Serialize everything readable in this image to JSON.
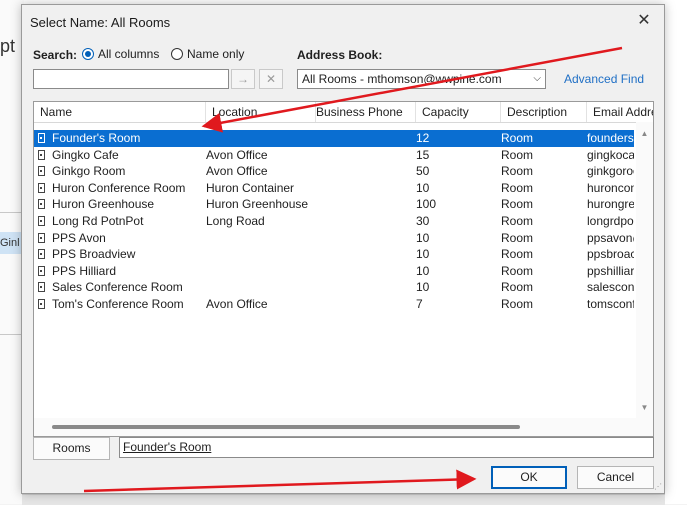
{
  "background": {
    "partial_title": "pt",
    "partial_item": "Ginl"
  },
  "dialog": {
    "title": "Select Name: All Rooms"
  },
  "search": {
    "label": "Search:",
    "option_all": "All columns",
    "option_name": "Name only",
    "selected_option": "All columns",
    "value": "",
    "go_icon": "arrow-right-icon",
    "clear_icon": "x-icon"
  },
  "address_book": {
    "label": "Address Book:",
    "value": "All Rooms - mthomson@wwpine.com",
    "advanced_find": "Advanced Find"
  },
  "columns": [
    "Name",
    "Location",
    "Business Phone",
    "Capacity",
    "Description",
    "Email Addre"
  ],
  "rows": [
    {
      "name": "Founder's Room",
      "location": "",
      "phone": "",
      "capacity": "12",
      "description": "Room",
      "email": "foundersi"
    },
    {
      "name": "Gingko Cafe",
      "location": "Avon Office",
      "phone": "",
      "capacity": "15",
      "description": "Room",
      "email": "gingkocaf"
    },
    {
      "name": "Ginkgo Room",
      "location": "Avon Office",
      "phone": "",
      "capacity": "50",
      "description": "Room",
      "email": "ginkgoroo"
    },
    {
      "name": "Huron Conference Room",
      "location": "Huron Container",
      "phone": "",
      "capacity": "10",
      "description": "Room",
      "email": "huroncon"
    },
    {
      "name": "Huron Greenhouse",
      "location": "Huron Greenhouse",
      "phone": "",
      "capacity": "100",
      "description": "Room",
      "email": "hurongre"
    },
    {
      "name": "Long Rd PotnPot",
      "location": "Long Road",
      "phone": "",
      "capacity": "30",
      "description": "Room",
      "email": "longrdpo"
    },
    {
      "name": "PPS Avon",
      "location": "",
      "phone": "",
      "capacity": "10",
      "description": "Room",
      "email": "ppsavon@"
    },
    {
      "name": "PPS Broadview",
      "location": "",
      "phone": "",
      "capacity": "10",
      "description": "Room",
      "email": "ppsbroac"
    },
    {
      "name": "PPS Hilliard",
      "location": "",
      "phone": "",
      "capacity": "10",
      "description": "Room",
      "email": "ppshilliar"
    },
    {
      "name": "Sales Conference Room",
      "location": "",
      "phone": "",
      "capacity": "10",
      "description": "Room",
      "email": "salesconf"
    },
    {
      "name": "Tom's Conference Room",
      "location": "Avon Office",
      "phone": "",
      "capacity": "7",
      "description": "Room",
      "email": "tomsconfe"
    }
  ],
  "selected_row_index": 0,
  "footer": {
    "rooms_button": "Rooms",
    "selected_value": "Founder's Room",
    "ok": "OK",
    "cancel": "Cancel"
  },
  "colors": {
    "selection": "#0a6ed1",
    "accent": "#005fb8",
    "link": "#1f6fc5",
    "annotation": "#e0191e"
  }
}
